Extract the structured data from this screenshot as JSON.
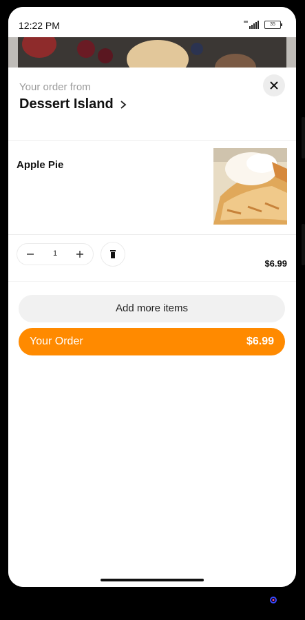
{
  "status_bar": {
    "time": "12:22 PM",
    "battery": "35"
  },
  "header": {
    "subtitle": "Your order from",
    "store_name": "Dessert Island",
    "close_icon": "close-icon",
    "chevron_icon": "chevron-right-icon"
  },
  "cart": {
    "items": [
      {
        "name": "Apple Pie",
        "quantity": "1",
        "price": "$6.99",
        "image": "apple-pie-photo"
      }
    ]
  },
  "actions": {
    "add_more_label": "Add more items",
    "your_order_label": "Your Order",
    "your_order_total": "$6.99"
  },
  "colors": {
    "accent": "#ff8a00",
    "secondary_button": "#f1f1f1"
  }
}
